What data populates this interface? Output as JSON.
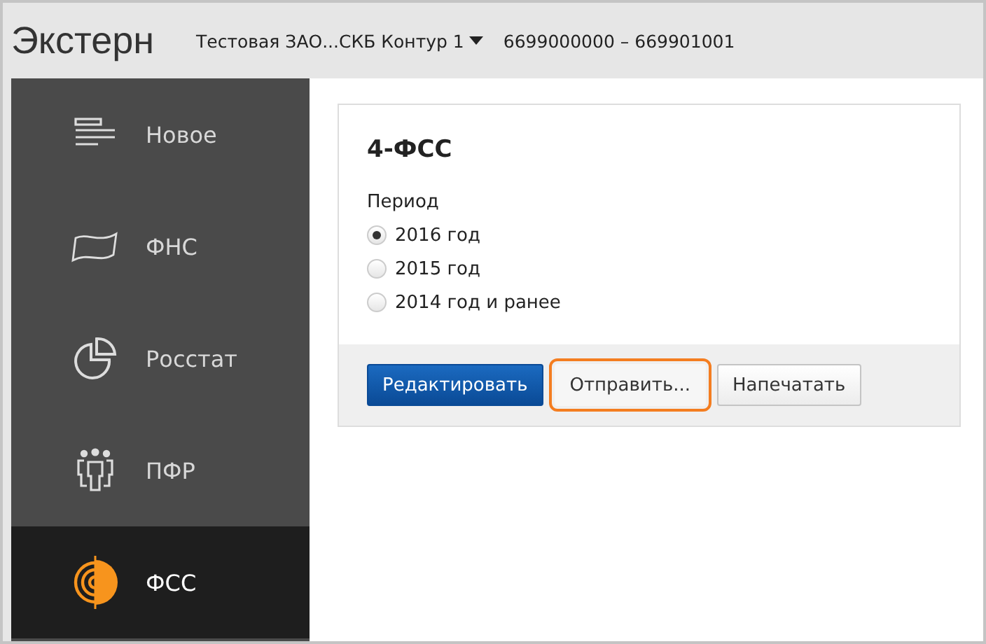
{
  "header": {
    "logo": "Экстерн",
    "organization": "Тестовая ЗАО...СКБ Контур 1",
    "inn_kpp": "6699000000 – 669901001"
  },
  "sidebar": {
    "items": [
      {
        "label": "Новое",
        "kind": "new",
        "selected": false
      },
      {
        "label": "ФНС",
        "kind": "fns",
        "selected": false
      },
      {
        "label": "Росстат",
        "kind": "rosstat",
        "selected": false
      },
      {
        "label": "ПФР",
        "kind": "pfr",
        "selected": false
      },
      {
        "label": "ФСС",
        "kind": "fss",
        "selected": true
      }
    ]
  },
  "card": {
    "title": "4-ФСС",
    "period_label": "Период",
    "periods": [
      {
        "label": "2016 год",
        "selected": true
      },
      {
        "label": "2015 год",
        "selected": false
      },
      {
        "label": "2014 год и ранее",
        "selected": false
      }
    ],
    "buttons": [
      {
        "label": "Редактировать",
        "kind": "primary",
        "focused": false
      },
      {
        "label": "Отправить...",
        "kind": "default",
        "focused": true
      },
      {
        "label": "Напечатать",
        "kind": "default",
        "focused": false
      }
    ]
  }
}
